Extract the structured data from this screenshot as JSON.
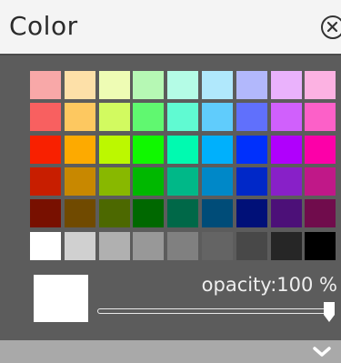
{
  "panel": {
    "title": "Color",
    "close_icon": "close-circle-icon",
    "expand_icon": "chevron-down-icon"
  },
  "palette": {
    "rows": [
      [
        "#f8a8a8",
        "#fde0a8",
        "#eefcb4",
        "#b6f8b4",
        "#b4fce6",
        "#b0e8fc",
        "#b2b8fc",
        "#eab2fc",
        "#fcb2e2"
      ],
      [
        "#f86060",
        "#fdc860",
        "#d2fa60",
        "#60f870",
        "#60fad2",
        "#60ccfc",
        "#6070fc",
        "#d060fc",
        "#fc60c8"
      ],
      [
        "#f82000",
        "#fdaa00",
        "#bcf800",
        "#10f800",
        "#00fab0",
        "#00b0fc",
        "#0030fc",
        "#b000fc",
        "#fc00a8"
      ],
      [
        "#c81e00",
        "#c88800",
        "#88b800",
        "#00b800",
        "#00b888",
        "#0088c8",
        "#0028c8",
        "#8820c8",
        "#c01888"
      ],
      [
        "#781000",
        "#704a00",
        "#4c6800",
        "#006800",
        "#006848",
        "#004c78",
        "#001078",
        "#4c1078",
        "#700c4c"
      ],
      [
        "#ffffff",
        "#d0d0d0",
        "#b0b0b0",
        "#989898",
        "#808080",
        "#646464",
        "#484848",
        "#262626",
        "#000000"
      ]
    ]
  },
  "preview": {
    "color": "#ffffff"
  },
  "opacity": {
    "label": "opacity:100 %",
    "value": 100
  }
}
